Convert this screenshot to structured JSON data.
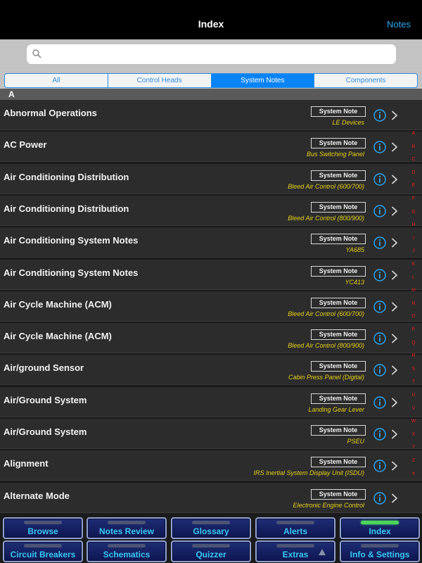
{
  "navbar": {
    "title": "Index",
    "right_label": "Notes"
  },
  "search": {
    "placeholder": "",
    "icon": "search-icon"
  },
  "segments": [
    {
      "label": "All",
      "active": false
    },
    {
      "label": "Control Heads",
      "active": false
    },
    {
      "label": "System Notes",
      "active": true
    },
    {
      "label": "Components",
      "active": false
    }
  ],
  "section": {
    "letter": "A"
  },
  "rows": [
    {
      "title": "Abnormal Operations",
      "badge": "System Note",
      "sub": "LE Devices"
    },
    {
      "title": "AC Power",
      "badge": "System Note",
      "sub": "Bus Switching Panel"
    },
    {
      "title": "Air Conditioning Distribution",
      "badge": "System Note",
      "sub": "Bleed Air Control (600/700)"
    },
    {
      "title": "Air Conditioning Distribution",
      "badge": "System Note",
      "sub": "Bleed Air Control (800/900)"
    },
    {
      "title": "Air Conditioning System Notes",
      "badge": "System Note",
      "sub": "YA685"
    },
    {
      "title": "Air Conditioning System Notes",
      "badge": "System Note",
      "sub": "YC413"
    },
    {
      "title": "Air Cycle Machine (ACM)",
      "badge": "System Note",
      "sub": "Bleed Air Control (600/700)"
    },
    {
      "title": "Air Cycle Machine (ACM)",
      "badge": "System Note",
      "sub": "Bleed Air Control (800/900)"
    },
    {
      "title": "Air/ground Sensor",
      "badge": "System Note",
      "sub": "Cabin Press Panel (Digital)"
    },
    {
      "title": "Air/Ground System",
      "badge": "System Note",
      "sub": "Landing Gear Lever"
    },
    {
      "title": "Air/Ground System",
      "badge": "System Note",
      "sub": "PSEU"
    },
    {
      "title": "Alignment",
      "badge": "System Note",
      "sub": "IRS Inertial System Display Unit (ISDU)"
    },
    {
      "title": "Alternate Mode",
      "badge": "System Note",
      "sub": "Electronic Engine Control"
    }
  ],
  "alpha_index": [
    "A",
    "B",
    "C",
    "D",
    "E",
    "F",
    "G",
    "H",
    "I",
    "J",
    "K",
    "L",
    "M",
    "N",
    "O",
    "P",
    "Q",
    "R",
    "S",
    "T",
    "U",
    "V",
    "W",
    "X",
    "Y",
    "Z",
    "#"
  ],
  "tabs_row1": [
    {
      "label": "Browse",
      "active": false
    },
    {
      "label": "Notes Review",
      "active": false
    },
    {
      "label": "Glossary",
      "active": false
    },
    {
      "label": "Alerts",
      "active": false
    },
    {
      "label": "Index",
      "active": true
    }
  ],
  "tabs_row2": [
    {
      "label": "Circuit Breakers"
    },
    {
      "label": "Schematics"
    },
    {
      "label": "Quizzer"
    },
    {
      "label": "Extras"
    },
    {
      "label": "Info & Settings"
    }
  ],
  "colors": {
    "accent": "#2aa8f2",
    "subtitle": "#e8d21a",
    "index_letters": "#e02020",
    "tab_text": "#38c8f4",
    "active_led": "#4cd65b"
  }
}
